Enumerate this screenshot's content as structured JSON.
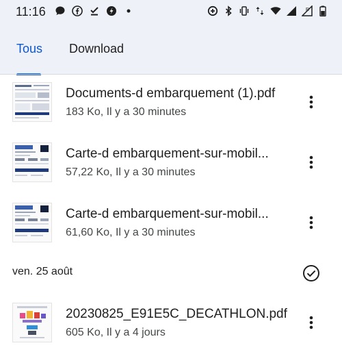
{
  "status_bar": {
    "time": "11:16",
    "left_icons": [
      "chat-icon",
      "facebook-icon",
      "download-done-icon",
      "app-icon",
      "dot-icon"
    ],
    "right_icons": [
      "data-saver-icon",
      "bluetooth-icon",
      "vibrate-icon",
      "wifi-icon",
      "signal-icon",
      "signal-roaming-icon",
      "battery-icon"
    ]
  },
  "tabs": [
    {
      "label": "Tous",
      "selected": true
    },
    {
      "label": "Download",
      "selected": false
    }
  ],
  "files": [
    {
      "name": "Documents-d embarquement (1).pdf",
      "meta": "183 Ko, Il y a 30 minutes"
    },
    {
      "name": "Carte-d embarquement-sur-mobil...",
      "meta": "57,22 Ko, Il y a 30 minutes"
    },
    {
      "name": "Carte-d embarquement-sur-mobil...",
      "meta": "61,60 Ko, Il y a 30 minutes"
    }
  ],
  "section": {
    "label": "ven. 25 août",
    "files": [
      {
        "name": "20230825_E91E5C_DECATHLON.pdf",
        "meta": "605 Ko, Il y a 4 jours"
      }
    ]
  },
  "colors": {
    "accent": "#0b57d0",
    "header_bg": "#eef1f8",
    "text": "#1f1f1f",
    "secondary": "#444746"
  }
}
